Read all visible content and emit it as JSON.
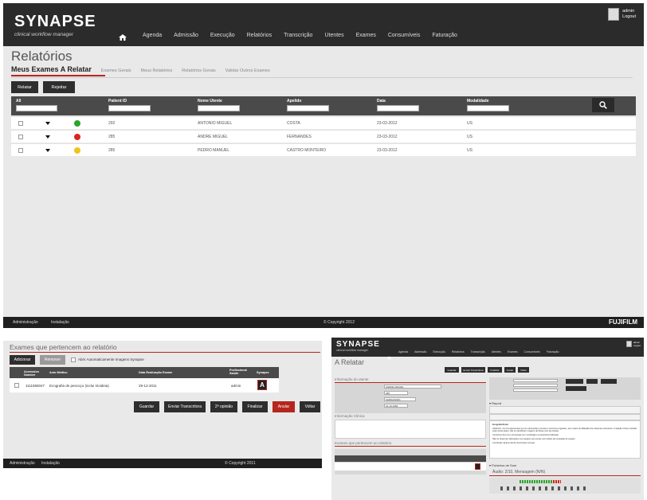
{
  "main": {
    "brand": {
      "title": "SYNAPSE",
      "subtitle": "clinical workflow manager"
    },
    "nav": [
      "Agenda",
      "Admissão",
      "Execução",
      "Relatórios",
      "Transcrição",
      "Utentes",
      "Exames",
      "Consumíveis",
      "Faturação"
    ],
    "user": {
      "name": "admin",
      "logout": "Logout"
    },
    "page_title": "Relatórios",
    "tabs": [
      "Meus Exames A Relatar",
      "Exames Gerais",
      "Meus Relatórios",
      "Relatórios Gerais",
      "Validar Outros Exames"
    ],
    "actions": {
      "relatar": "Relatar",
      "rejeitar": "Rejeitar"
    },
    "columns": [
      "All",
      "Patient ID",
      "Nome Utente",
      "Apelido",
      "Data",
      "Modalidade"
    ],
    "rows": [
      {
        "id": "292",
        "nome": "ANTONIO MIGUEL",
        "apelido": "COSTA",
        "data": "23-03-2012",
        "mod": "US",
        "status": "#2aa52a"
      },
      {
        "id": "285",
        "nome": "ANDRE MIGUEL",
        "apelido": "FERNANDES",
        "data": "23-03-2012",
        "mod": "US",
        "status": "#d9261c"
      },
      {
        "id": "285",
        "nome": "PEDRO MANUEL",
        "apelido": "CASTRO MONTEIRO",
        "data": "23-03-2012",
        "mod": "US",
        "status": "#f2c21b"
      }
    ],
    "footer": {
      "admin": "Administração",
      "install": "Instalação",
      "copyright": "© Copyright 2012",
      "logo": "FUJIFILM"
    }
  },
  "left_panel": {
    "title": "Exames que pertencem ao relatório",
    "buttons": {
      "adicionar": "Adicionar",
      "remover": "Remover"
    },
    "checkbox_label": "Abrir Automaticamente Imagens Synapse",
    "columns": [
      "Accession Number",
      "Acto Médico",
      "Data Realização Exame",
      "Profissional Saúde",
      "Synapse"
    ],
    "row": {
      "accession": "1111555047",
      "acto": "Ecografia de pescoço (inclui tiroideia)",
      "data": "29-12-2011",
      "prof": "admin",
      "icon": "A"
    },
    "actions": [
      "Guardar",
      "Enviar Transcritora",
      "2ª opinião",
      "Finalizar",
      "Anular",
      "Voltar"
    ],
    "footer": {
      "admin": "Administração",
      "install": "Instalação",
      "copyright": "© Copyright 2011"
    }
  },
  "right_panel": {
    "brand": {
      "title": "SYNAPSE",
      "subtitle": "clinical workflow manager"
    },
    "nav": [
      "Agenda",
      "Admissão",
      "Execução",
      "Relatórios",
      "Transcrição",
      "Utentes",
      "Exames",
      "Consumíveis",
      "Faturação"
    ],
    "user": {
      "name": "admin",
      "logout": "Logout"
    },
    "title": "A Relatar",
    "toolbar": [
      "Guardar",
      "Enviar Transcritora",
      "Finalizar",
      "Anular",
      "Voltar"
    ],
    "section_info": "Informação do utente",
    "section_clinical": "Informação Clínica",
    "section_exams": "Exames que pertencem ao relatório",
    "section_report": "Report",
    "fields": {
      "nome": "ANDRE MIGUEL",
      "n_proc": "285",
      "apelido": "FERNANDES",
      "nasc": "01-10-1982"
    },
    "report_heading": "Ecografia Renal",
    "report_lines": [
      "Abdómen: Os rins apresentam-se com dimensões normais e contornos regulares, sem sinais de dilatação dos sistemas excretores. A relação cortico-medular está conservada e não se identificam imagens de litíase nem de ectasia.",
      "Contornos dos rins e da bexiga com morfologia e ecoestrutura habituais.",
      "Não se observam alterações nos espaços peri-renais nem lesões de ocupação de espaço.",
      "Conclusão: Exame dentro dos limites normais."
    ],
    "audio_section": "Ficheiros de Som",
    "audio_title": "Áudio: 2/10, Mensagem (N/N)"
  }
}
